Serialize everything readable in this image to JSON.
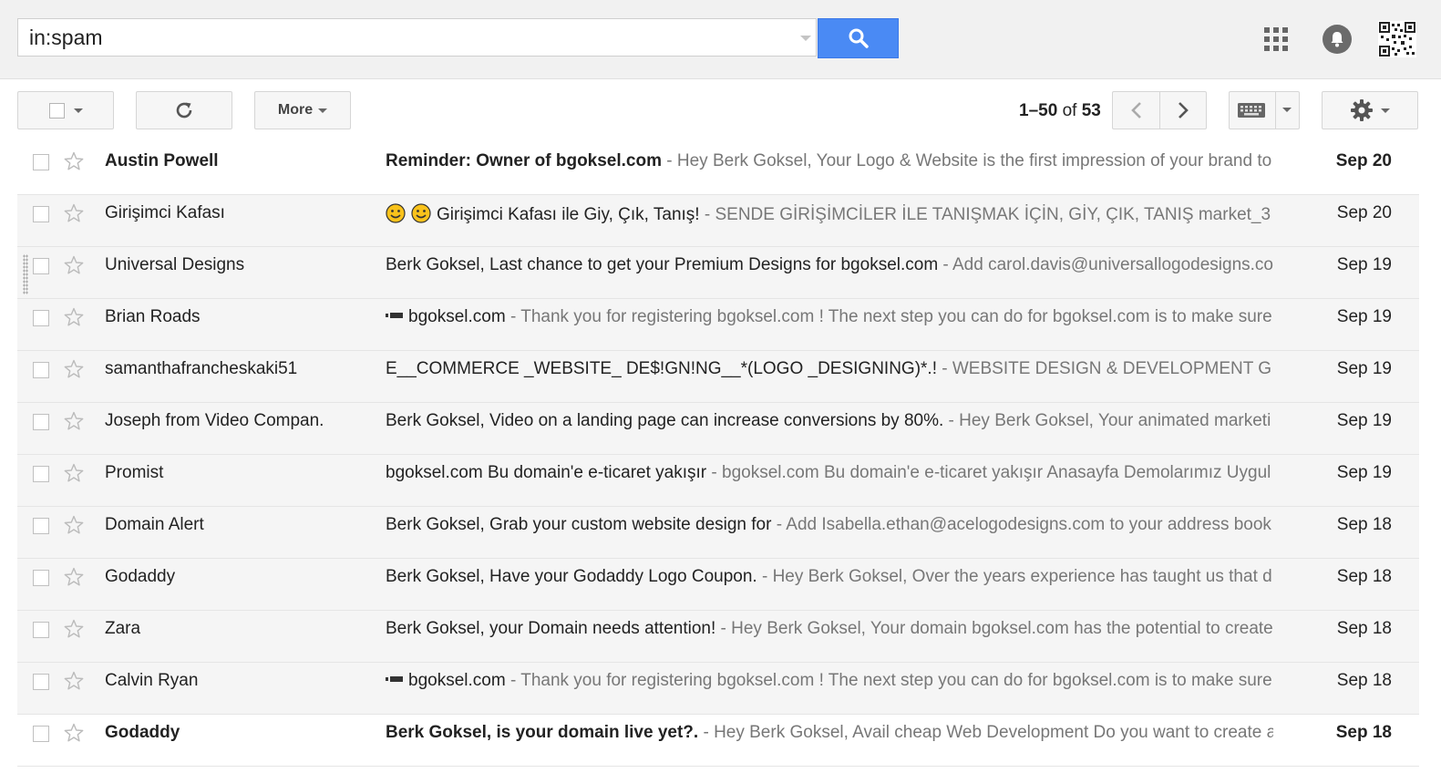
{
  "search": {
    "value": "in:spam"
  },
  "toolbar": {
    "more_label": "More",
    "pager": {
      "range": "1–50",
      "of_label": "of",
      "total": "53"
    }
  },
  "icons": {
    "search": "search-icon",
    "apps": "apps-grid-icon",
    "notifications": "notifications-icon",
    "refresh": "refresh-icon",
    "prev": "chevron-left-icon",
    "next": "chevron-right-icon",
    "keyboard": "keyboard-icon",
    "settings": "gear-icon",
    "star": "star-icon"
  },
  "colors": {
    "search_button": "#4a8af4",
    "unread_row": "#ffffff",
    "read_row": "#f5f5f5",
    "snippet": "#777777"
  },
  "messages": [
    {
      "sender": "Austin Powell",
      "subject": "Reminder: Owner of bgoksel.com",
      "snippet": " - Hey Berk Goksel, Your Logo & Website is the first impression of your brand to",
      "date": "Sep 20",
      "unread": true,
      "prefix": ""
    },
    {
      "sender": "Girişimci Kafası",
      "subject": "Girişimci Kafası ile Giy, Çık, Tanış!",
      "snippet": " - SENDE GİRİŞİMCİLER İLE TANIŞMAK İÇİN, GİY, ÇIK, TANIŞ market_3",
      "date": "Sep 20",
      "unread": false,
      "prefix": "emoji"
    },
    {
      "sender": "Universal Designs",
      "subject": "Berk Goksel, Last chance to get your Premium Designs for bgoksel.com",
      "snippet": " - Add carol.davis@universallogodesigns.com",
      "date": "Sep 19",
      "unread": false,
      "prefix": ""
    },
    {
      "sender": "Brian Roads",
      "subject": "bgoksel.com",
      "snippet": " - Thank you for registering bgoksel.com ! The next step you can do for bgoksel.com is to make sure",
      "date": "Sep 19",
      "unread": false,
      "prefix": "dash"
    },
    {
      "sender": "samanthafrancheskaki51",
      "subject": "E__COMMERCE _WEBSITE_ DE$!GN!NG__*(LOGO _DESIGNING)*.!",
      "snippet": " - WEBSITE DESIGN & DEVELOPMENT G",
      "date": "Sep 19",
      "unread": false,
      "prefix": ""
    },
    {
      "sender": "Joseph from Video Compan.",
      "subject": "Berk Goksel, Video on a landing page can increase conversions by 80%.",
      "snippet": " - Hey Berk Goksel, Your animated marketi",
      "date": "Sep 19",
      "unread": false,
      "prefix": ""
    },
    {
      "sender": "Promist",
      "subject": "bgoksel.com Bu domain'e e-ticaret yakışır",
      "snippet": " - bgoksel.com Bu domain'e e-ticaret yakışır Anasayfa Demolarımız Uygul",
      "date": "Sep 19",
      "unread": false,
      "prefix": ""
    },
    {
      "sender": "Domain Alert",
      "subject": "Berk Goksel, Grab your custom website design for",
      "snippet": " - Add Isabella.ethan@acelogodesigns.com to your address book",
      "date": "Sep 18",
      "unread": false,
      "prefix": ""
    },
    {
      "sender": "Godaddy",
      "subject": "Berk Goksel, Have your Godaddy Logo Coupon.",
      "snippet": " - Hey Berk Goksel, Over the years experience has taught us that d",
      "date": "Sep 18",
      "unread": false,
      "prefix": ""
    },
    {
      "sender": "Zara",
      "subject": "Berk Goksel, your Domain needs attention!",
      "snippet": " - Hey Berk Goksel, Your domain bgoksel.com has the potential to create",
      "date": "Sep 18",
      "unread": false,
      "prefix": ""
    },
    {
      "sender": "Calvin Ryan",
      "subject": "bgoksel.com",
      "snippet": " - Thank you for registering bgoksel.com ! The next step you can do for bgoksel.com is to make sure",
      "date": "Sep 18",
      "unread": false,
      "prefix": "dash"
    },
    {
      "sender": "Godaddy",
      "subject": "Berk Goksel, is your domain live yet?.",
      "snippet": " - Hey Berk Goksel, Avail cheap Web Development Do you want to create a",
      "date": "Sep 18",
      "unread": true,
      "prefix": ""
    }
  ]
}
